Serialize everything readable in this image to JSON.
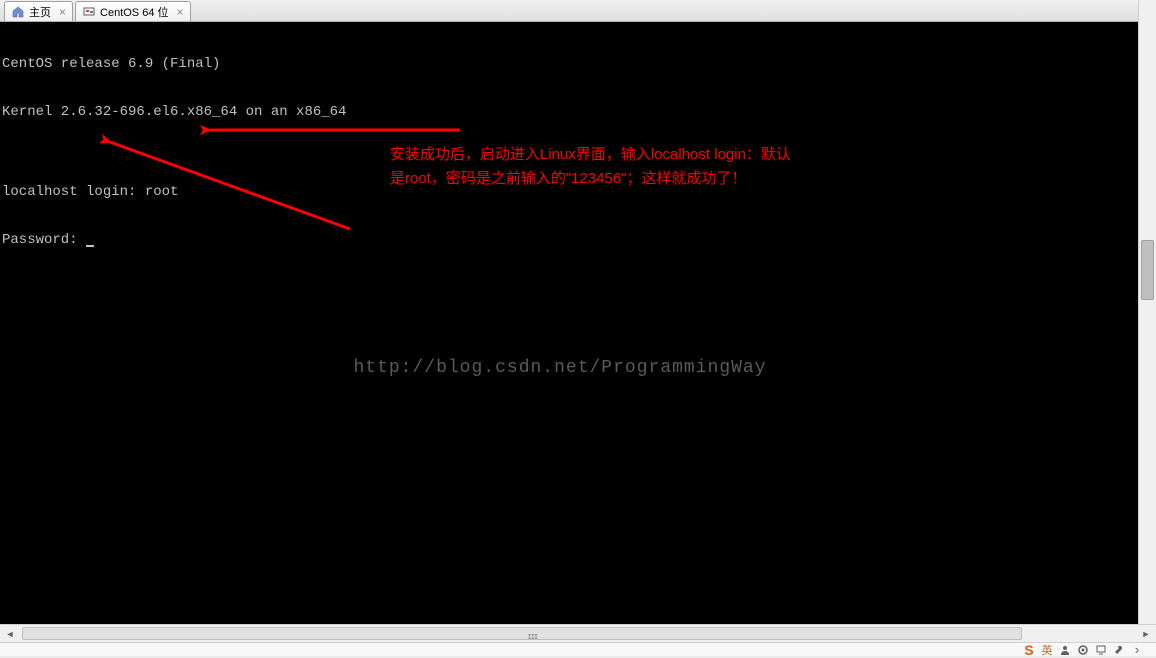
{
  "tabs": {
    "home": {
      "label": "主页"
    },
    "centos": {
      "label": "CentOS 64 位"
    }
  },
  "terminal": {
    "line1": "CentOS release 6.9 (Final)",
    "line2": "Kernel 2.6.32-696.el6.x86_64 on an x86_64",
    "line3": "",
    "line4_prefix": "localhost login: ",
    "line4_value": "root",
    "line5": "Password: "
  },
  "annotation": {
    "line1": "安装成功后，启动进入Linux界面，输入localhost login：默认",
    "line2": "是root，密码是之前输入的\"123456\"；这样就成功了！"
  },
  "watermark": "http://blog.csdn.net/ProgrammingWay",
  "colors": {
    "annotation": "#ff0000",
    "terminal_bg": "#000000",
    "terminal_fg": "#c0c0c0"
  }
}
